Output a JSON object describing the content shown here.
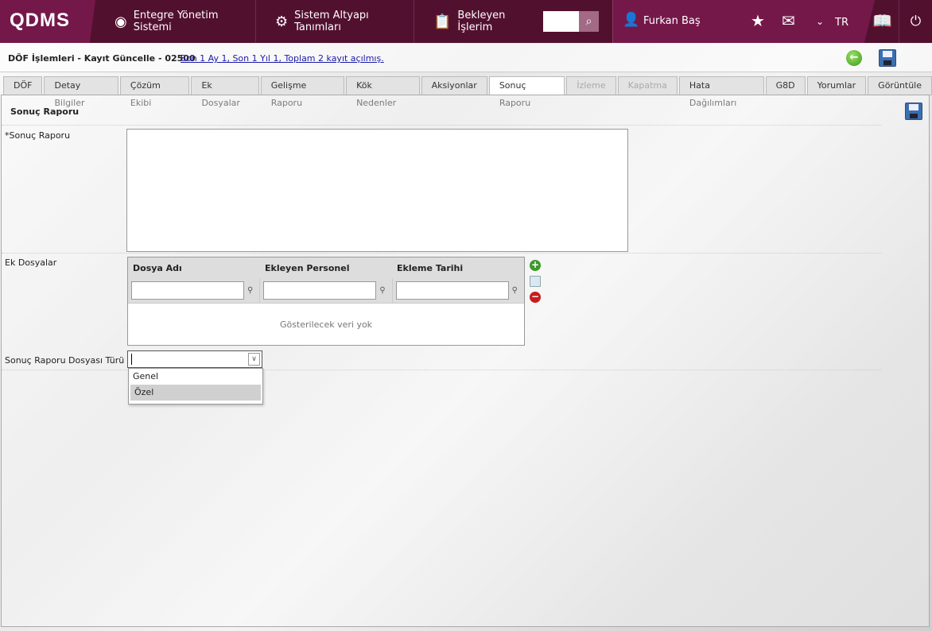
{
  "header": {
    "logo": "QDMS",
    "nav": [
      {
        "label": "Entegre Yönetim Sistemi",
        "icon": "qdms-icon"
      },
      {
        "label": "Sistem Altyapı Tanımları",
        "icon": "gear-icon"
      },
      {
        "label": "Bekleyen İşlerim",
        "icon": "clipboard-icon"
      }
    ],
    "user": "Furkan Baş",
    "language": "TR"
  },
  "toolbar": {
    "title": "DÖF İşlemleri - Kayıt Güncelle - 02500",
    "summary": "Son 1 Ay 1, Son 1 Yıl 1, Toplam 2 kayıt açılmış."
  },
  "tabs": [
    {
      "label": "DÖF"
    },
    {
      "label": "Detay Bilgiler"
    },
    {
      "label": "Çözüm Ekibi"
    },
    {
      "label": "Ek Dosyalar"
    },
    {
      "label": "Gelişme Raporu"
    },
    {
      "label": "Kök Nedenler"
    },
    {
      "label": "Aksiyonlar"
    },
    {
      "label": "Sonuç Raporu"
    },
    {
      "label": "İzleme"
    },
    {
      "label": "Kapatma"
    },
    {
      "label": "Hata Dağılımları"
    },
    {
      "label": "G8D"
    },
    {
      "label": "Yorumlar"
    },
    {
      "label": "Görüntüle"
    }
  ],
  "panel": {
    "title": "Sonuç Raporu",
    "report_label": "*Sonuç Raporu",
    "report_value": "",
    "files_label": "Ek Dosyalar",
    "columns": [
      "Dosya Adı",
      "Ekleyen Personel",
      "Ekleme Tarihi"
    ],
    "empty_text": "Gösterilecek veri yok",
    "type_label": "Sonuç Raporu Dosyası Türü",
    "type_options": [
      "Genel",
      "Özel"
    ]
  }
}
